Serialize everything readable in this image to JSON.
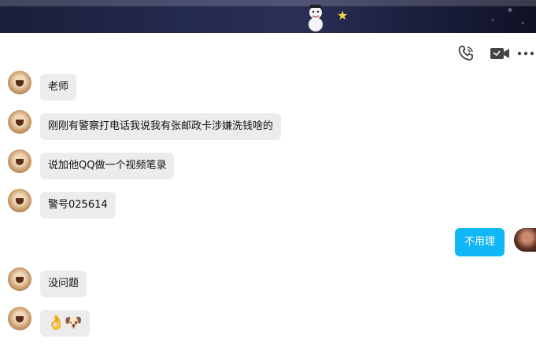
{
  "toolbar": {
    "voice_call_icon": "phone-icon",
    "video_call_icon": "video-camera-icon",
    "more_icon": "more-dots-icon"
  },
  "messages": [
    {
      "side": "left",
      "text": "老师"
    },
    {
      "side": "left",
      "text": "刚刚有警察打电话我说我有张邮政卡涉嫌洗钱啥的"
    },
    {
      "side": "left",
      "text": "说加他QQ做一个视频笔录"
    },
    {
      "side": "left",
      "text": "警号025614"
    },
    {
      "side": "right",
      "text": "不用理"
    },
    {
      "side": "left",
      "text": "没问题"
    },
    {
      "side": "left",
      "text": "👌🐶"
    }
  ],
  "colors": {
    "incoming_bubble": "#ececec",
    "outgoing_bubble": "#12b7f5",
    "banner": "#1a1f3a"
  }
}
